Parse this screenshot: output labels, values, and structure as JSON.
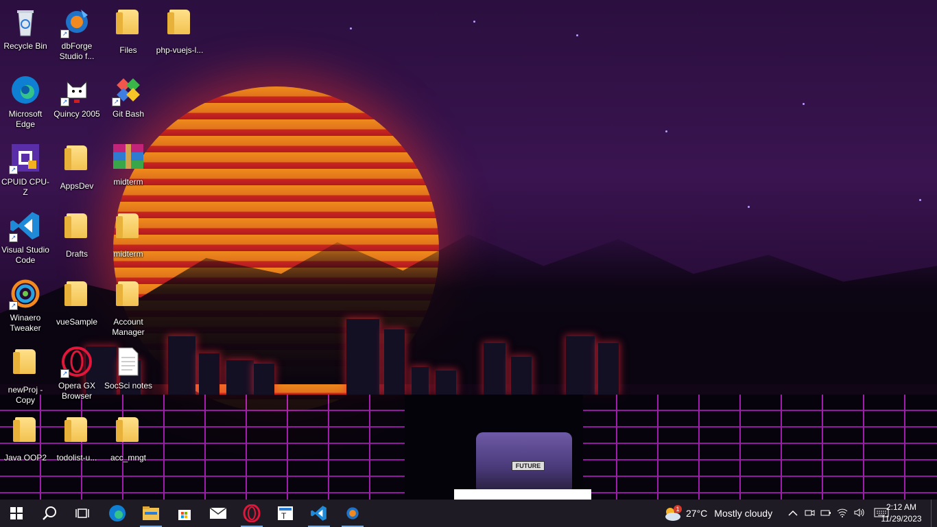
{
  "desktop": {
    "icons": [
      {
        "label": "Recycle Bin",
        "icon": "recycle-bin-icon"
      },
      {
        "label": "dbForge Studio f...",
        "icon": "dbforge-icon"
      },
      {
        "label": "Files",
        "icon": "folder-icon"
      },
      {
        "label": "php-vuejs-l...",
        "icon": "folder-icon"
      },
      {
        "label": "Microsoft Edge",
        "icon": "edge-icon"
      },
      {
        "label": "Quincy 2005",
        "icon": "quincy-icon"
      },
      {
        "label": "Git Bash",
        "icon": "git-bash-icon"
      },
      {
        "label": "CPUID CPU-Z",
        "icon": "cpuz-icon"
      },
      {
        "label": "AppsDev",
        "icon": "folder-icon"
      },
      {
        "label": "midterm",
        "icon": "winrar-icon"
      },
      {
        "label": "Visual Studio Code",
        "icon": "vscode-icon"
      },
      {
        "label": "Drafts",
        "icon": "folder-icon"
      },
      {
        "label": "midterm",
        "icon": "folder-icon"
      },
      {
        "label": "Winaero Tweaker",
        "icon": "winaero-icon"
      },
      {
        "label": "vueSample",
        "icon": "folder-icon"
      },
      {
        "label": "Account Manager",
        "icon": "folder-icon"
      },
      {
        "label": "newProj - Copy",
        "icon": "folder-icon"
      },
      {
        "label": "Opera GX Browser",
        "icon": "opera-gx-icon"
      },
      {
        "label": "SocSci notes",
        "icon": "text-document-icon"
      },
      {
        "label": "Java OOP2",
        "icon": "folder-icon"
      },
      {
        "label": "todolist-u...",
        "icon": "folder-icon"
      },
      {
        "label": "acc_mngt",
        "icon": "folder-icon"
      }
    ],
    "car_plate": "FUTURE"
  },
  "taskbar": {
    "apps": [
      {
        "name": "start",
        "icon": "windows-start-icon"
      },
      {
        "name": "search",
        "icon": "search-icon"
      },
      {
        "name": "task-view",
        "icon": "task-view-icon"
      },
      {
        "name": "edge",
        "icon": "edge-icon"
      },
      {
        "name": "file-explorer",
        "icon": "file-explorer-icon"
      },
      {
        "name": "microsoft-store",
        "icon": "store-icon"
      },
      {
        "name": "mail",
        "icon": "mail-icon"
      },
      {
        "name": "opera",
        "icon": "opera-icon"
      },
      {
        "name": "typing",
        "icon": "typing-icon"
      },
      {
        "name": "vscode",
        "icon": "vscode-icon"
      },
      {
        "name": "dbforge",
        "icon": "dbforge-icon"
      }
    ],
    "weather": {
      "temp": "27°C",
      "condition": "Mostly cloudy",
      "badge": "1"
    },
    "clock": {
      "time": "2:12 AM",
      "date": "11/29/2023"
    }
  }
}
